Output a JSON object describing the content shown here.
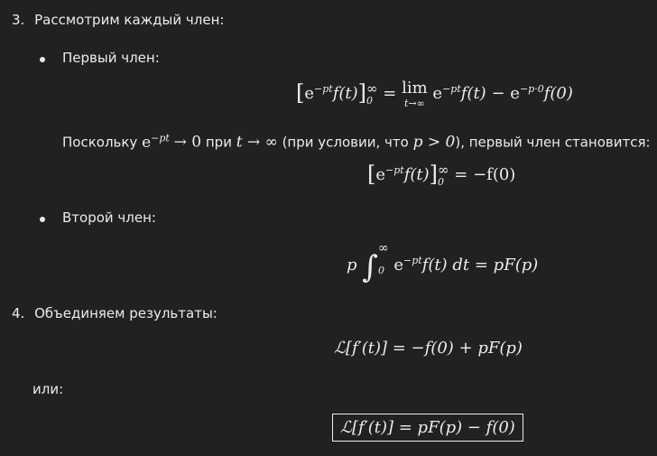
{
  "step3": {
    "number": "3.",
    "title": "Рассмотрим каждый член:"
  },
  "bullet1": {
    "label": "Первый член:"
  },
  "eq1": {
    "lhs_exp": "−pt",
    "lhs_fn": "f(t)",
    "upper": "∞",
    "lower": "0",
    "lim": "lim",
    "lim_sub": "t→∞",
    "rhs_exp": "−pt",
    "rhs_fn": "f(t)",
    "minus": "−",
    "exp2": "−p·0",
    "fn2": "f(0)"
  },
  "text1": {
    "before": "Поскольку",
    "exp": "−pt",
    "arrow_zero": "→ 0",
    "mid": "при",
    "t_to_inf": "t → ∞",
    "cond": "(при условии, что",
    "p_gt": "p > 0",
    "after": "), первый член становится:"
  },
  "eq2": {
    "exp": "−pt",
    "fn": "f(t)",
    "upper": "∞",
    "lower": "0",
    "rhs": "= −f(0)"
  },
  "bullet2": {
    "label": "Второй член:"
  },
  "eq3": {
    "p": "p",
    "upper": "∞",
    "lower": "0",
    "exp": "−pt",
    "body": "f(t) dt = pF(p)"
  },
  "step4": {
    "number": "4.",
    "title": "Объединяем результаты:"
  },
  "eq4": {
    "text": "ℒ[f′(t)] = −f(0) + pF(p)"
  },
  "or_label": "или:",
  "eq5": {
    "text": "ℒ[f′(t)] = pF(p) − f(0)"
  }
}
